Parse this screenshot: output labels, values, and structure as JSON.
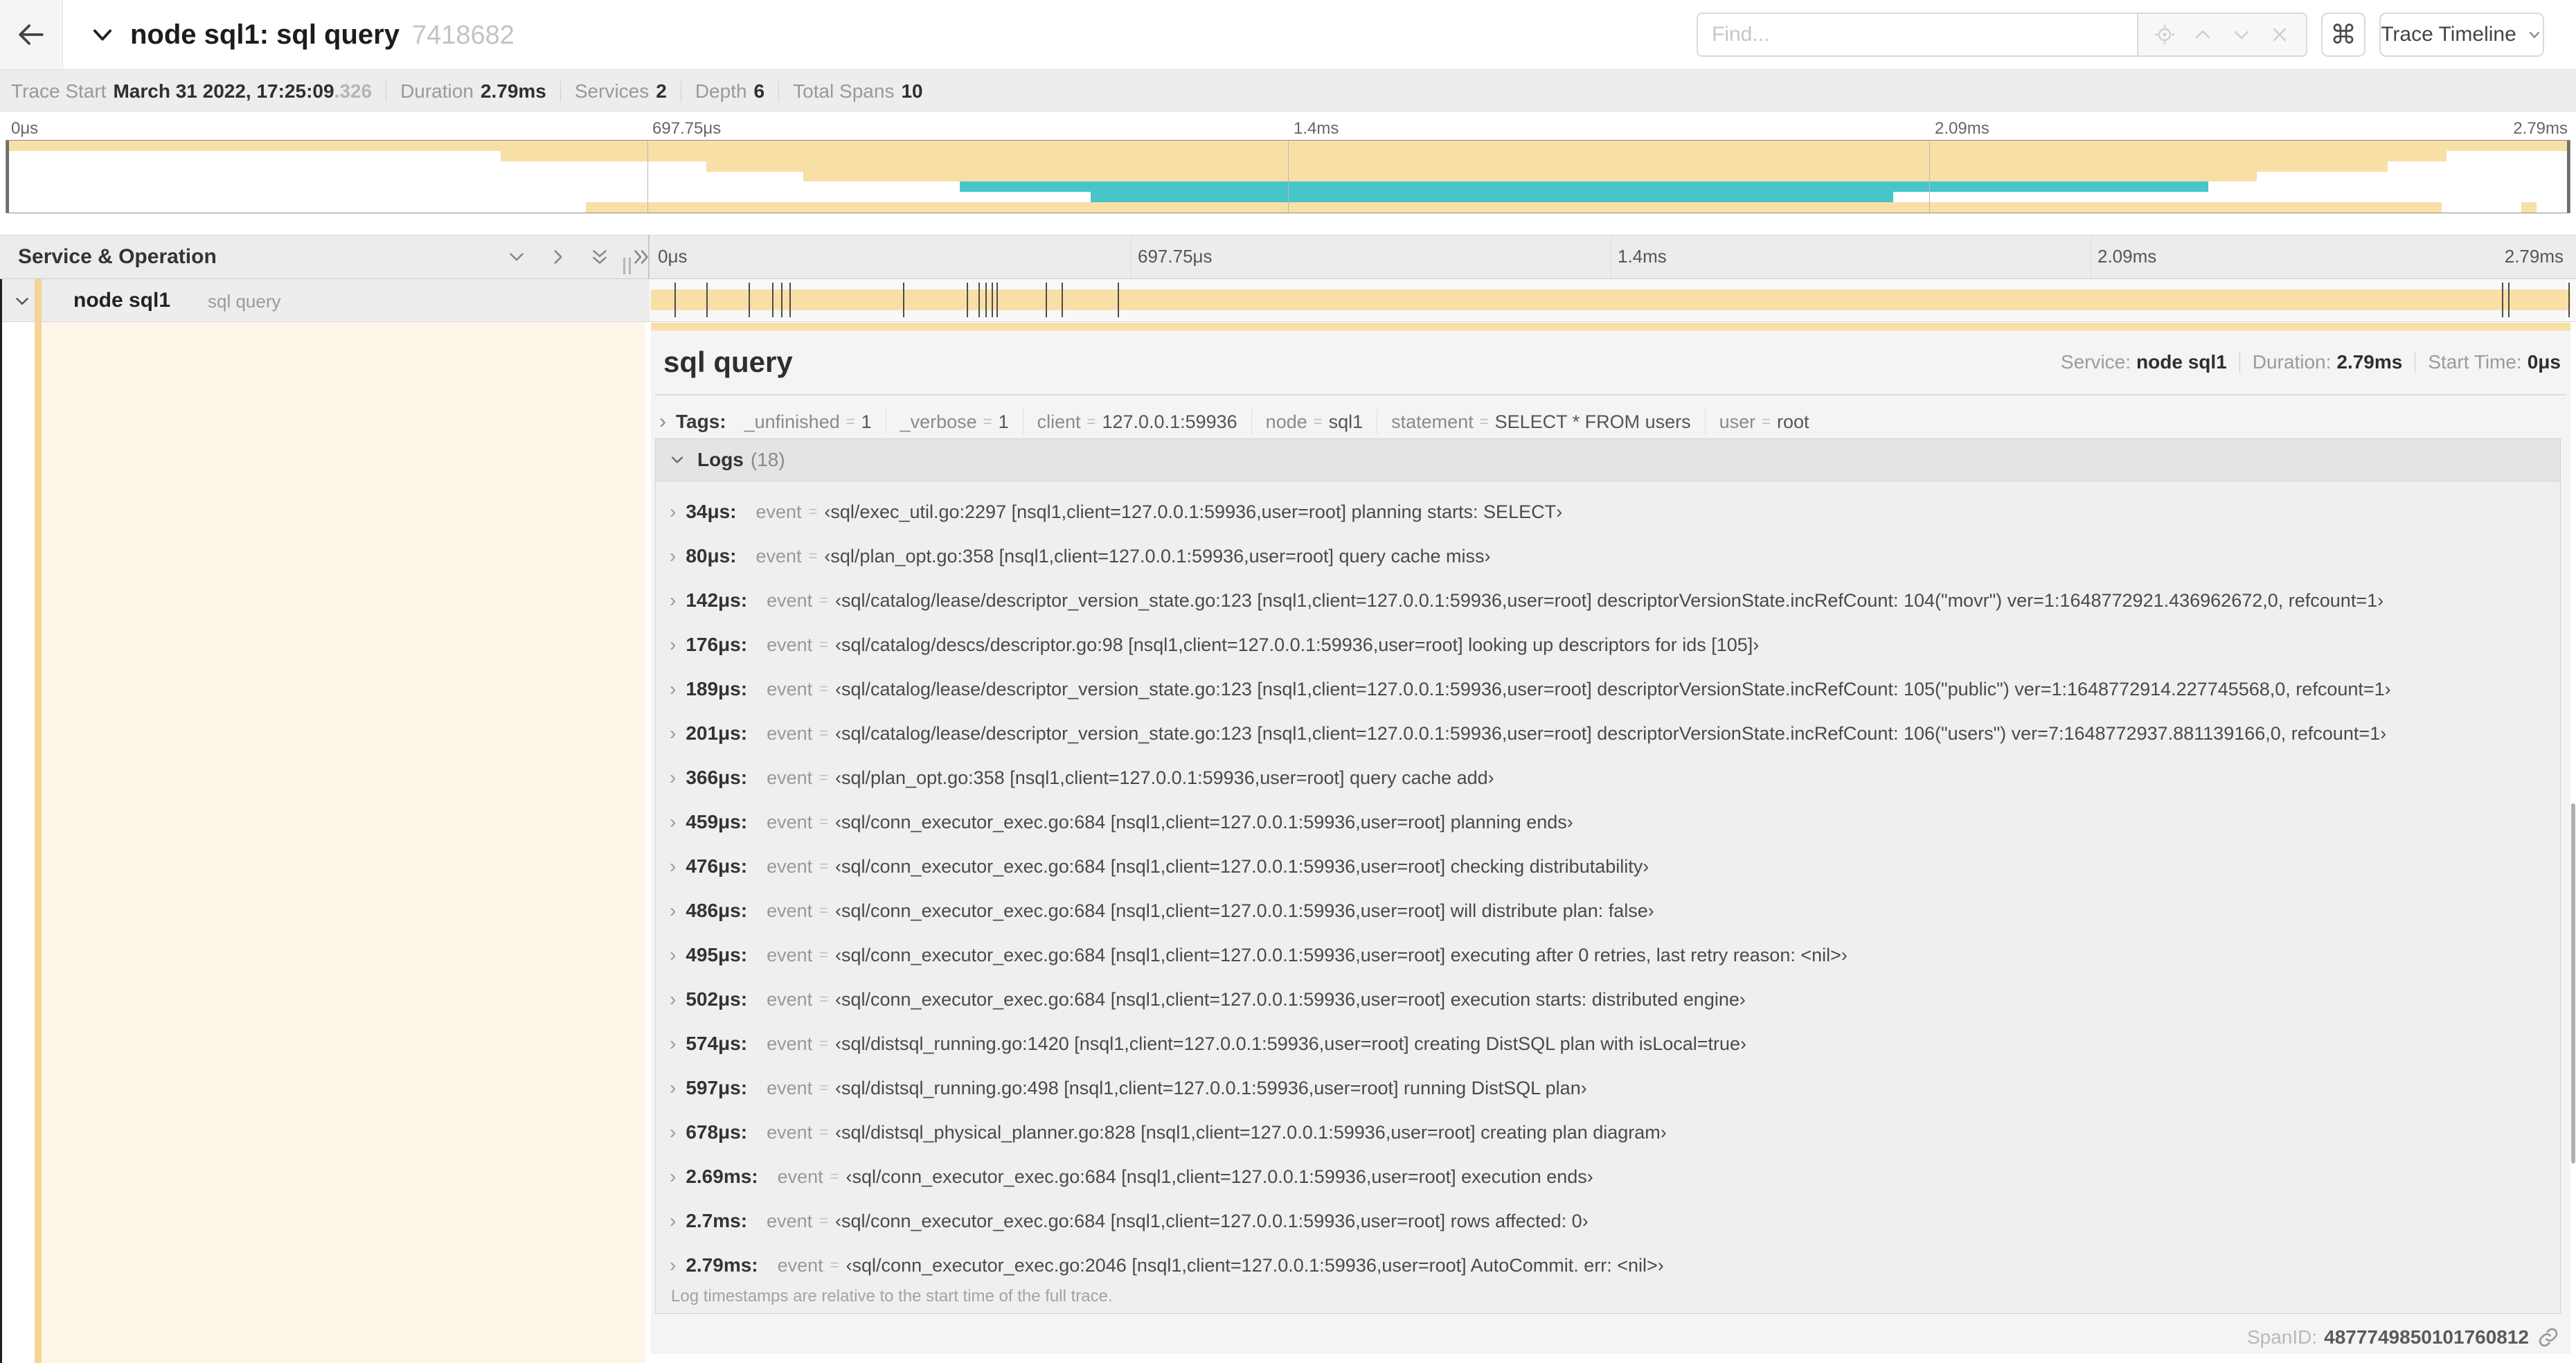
{
  "colors": {
    "tan": "#f8dfa6",
    "teal": "#48c5c9",
    "indent": "#f6d493",
    "cream": "#fdf5e7"
  },
  "header": {
    "back_icon": "arrow-left",
    "title": "node sql1: sql query",
    "trace_id": "7418682",
    "find_placeholder": "Find...",
    "shortcut_key": "⌘",
    "view_selector_label": "Trace Timeline"
  },
  "trace_info": {
    "trace_start_label": "Trace Start",
    "trace_start_value": "March 31 2022, 17:25:09",
    "trace_start_ms": ".326",
    "duration_label": "Duration",
    "duration_value": "2.79ms",
    "services_label": "Services",
    "services_value": "2",
    "depth_label": "Depth",
    "depth_value": "6",
    "total_spans_label": "Total Spans",
    "total_spans_value": "10"
  },
  "timeline": {
    "service_operation_label": "Service & Operation",
    "ticks": [
      {
        "label": "0μs",
        "pct": 0
      },
      {
        "label": "697.75μs",
        "pct": 25
      },
      {
        "label": "1.4ms",
        "pct": 50
      },
      {
        "label": "2.09ms",
        "pct": 75
      },
      {
        "label": "2.79ms",
        "pct": 100
      }
    ],
    "grid_pcts": [
      25,
      50,
      75
    ]
  },
  "minimap": {
    "bars": [
      {
        "row": 0,
        "start": 0,
        "end": 100,
        "color": "tan"
      },
      {
        "row": 1,
        "start": 19.3,
        "end": 95.2,
        "color": "tan"
      },
      {
        "row": 2,
        "start": 27.3,
        "end": 92.9,
        "color": "tan"
      },
      {
        "row": 3,
        "start": 31.1,
        "end": 87.8,
        "color": "tan"
      },
      {
        "row": 4,
        "start": 37.2,
        "end": 85.9,
        "color": "teal"
      },
      {
        "row": 5,
        "start": 42.3,
        "end": 73.6,
        "color": "teal"
      },
      {
        "row": 6,
        "start": 22.6,
        "end": 95.0,
        "color": "tan"
      },
      {
        "row": 6,
        "start": 98.1,
        "end": 98.7,
        "color": "tan"
      }
    ],
    "rows": 7
  },
  "span_row": {
    "service": "node sql1",
    "operation": "sql query",
    "log_tick_pcts": [
      1.22,
      2.87,
      5.09,
      6.31,
      6.78,
      7.2,
      13.12,
      16.45,
      17.06,
      17.42,
      17.74,
      18.0,
      20.57,
      21.4,
      24.3,
      96.42,
      96.77,
      99.9
    ]
  },
  "detail": {
    "operation": "sql query",
    "service_label": "Service:",
    "service_value": "node sql1",
    "duration_label": "Duration:",
    "duration_value": "2.79ms",
    "start_time_label": "Start Time:",
    "start_time_value": "0μs",
    "tags_label": "Tags:",
    "tags": [
      {
        "key": "_unfinished",
        "value": "1"
      },
      {
        "key": "_verbose",
        "value": "1"
      },
      {
        "key": "client",
        "value": "127.0.0.1:59936"
      },
      {
        "key": "node",
        "value": "sql1"
      },
      {
        "key": "statement",
        "value": "SELECT * FROM users"
      },
      {
        "key": "user",
        "value": "root"
      }
    ],
    "logs_label": "Logs",
    "logs_count": "(18)",
    "logs": [
      {
        "time": "34μs:",
        "field": "event",
        "value": "‹sql/exec_util.go:2297 [nsql1,client=127.0.0.1:59936,user=root] planning starts: SELECT›"
      },
      {
        "time": "80μs:",
        "field": "event",
        "value": "‹sql/plan_opt.go:358 [nsql1,client=127.0.0.1:59936,user=root] query cache miss›"
      },
      {
        "time": "142μs:",
        "field": "event",
        "value": "‹sql/catalog/lease/descriptor_version_state.go:123 [nsql1,client=127.0.0.1:59936,user=root] descriptorVersionState.incRefCount: 104(\"movr\") ver=1:1648772921.436962672,0, refcount=1›"
      },
      {
        "time": "176μs:",
        "field": "event",
        "value": "‹sql/catalog/descs/descriptor.go:98 [nsql1,client=127.0.0.1:59936,user=root] looking up descriptors for ids [105]›"
      },
      {
        "time": "189μs:",
        "field": "event",
        "value": "‹sql/catalog/lease/descriptor_version_state.go:123 [nsql1,client=127.0.0.1:59936,user=root] descriptorVersionState.incRefCount: 105(\"public\") ver=1:1648772914.227745568,0, refcount=1›"
      },
      {
        "time": "201μs:",
        "field": "event",
        "value": "‹sql/catalog/lease/descriptor_version_state.go:123 [nsql1,client=127.0.0.1:59936,user=root] descriptorVersionState.incRefCount: 106(\"users\") ver=7:1648772937.881139166,0, refcount=1›"
      },
      {
        "time": "366μs:",
        "field": "event",
        "value": "‹sql/plan_opt.go:358 [nsql1,client=127.0.0.1:59936,user=root] query cache add›"
      },
      {
        "time": "459μs:",
        "field": "event",
        "value": "‹sql/conn_executor_exec.go:684 [nsql1,client=127.0.0.1:59936,user=root] planning ends›"
      },
      {
        "time": "476μs:",
        "field": "event",
        "value": "‹sql/conn_executor_exec.go:684 [nsql1,client=127.0.0.1:59936,user=root] checking distributability›"
      },
      {
        "time": "486μs:",
        "field": "event",
        "value": "‹sql/conn_executor_exec.go:684 [nsql1,client=127.0.0.1:59936,user=root] will distribute plan: false›"
      },
      {
        "time": "495μs:",
        "field": "event",
        "value": "‹sql/conn_executor_exec.go:684 [nsql1,client=127.0.0.1:59936,user=root] executing after 0 retries, last retry reason: <nil>›"
      },
      {
        "time": "502μs:",
        "field": "event",
        "value": "‹sql/conn_executor_exec.go:684 [nsql1,client=127.0.0.1:59936,user=root] execution starts: distributed engine›"
      },
      {
        "time": "574μs:",
        "field": "event",
        "value": "‹sql/distsql_running.go:1420 [nsql1,client=127.0.0.1:59936,user=root] creating DistSQL plan with isLocal=true›"
      },
      {
        "time": "597μs:",
        "field": "event",
        "value": "‹sql/distsql_running.go:498 [nsql1,client=127.0.0.1:59936,user=root] running DistSQL plan›"
      },
      {
        "time": "678μs:",
        "field": "event",
        "value": "‹sql/distsql_physical_planner.go:828 [nsql1,client=127.0.0.1:59936,user=root] creating plan diagram›"
      },
      {
        "time": "2.69ms:",
        "field": "event",
        "value": "‹sql/conn_executor_exec.go:684 [nsql1,client=127.0.0.1:59936,user=root] execution ends›"
      },
      {
        "time": "2.7ms:",
        "field": "event",
        "value": "‹sql/conn_executor_exec.go:684 [nsql1,client=127.0.0.1:59936,user=root] rows affected: 0›"
      },
      {
        "time": "2.79ms:",
        "field": "event",
        "value": "‹sql/conn_executor_exec.go:2046 [nsql1,client=127.0.0.1:59936,user=root] AutoCommit. err: <nil>›"
      }
    ],
    "footer_note": "Log timestamps are relative to the start time of the full trace.",
    "span_id_label": "SpanID:",
    "span_id_value": "4877749850101760812"
  }
}
